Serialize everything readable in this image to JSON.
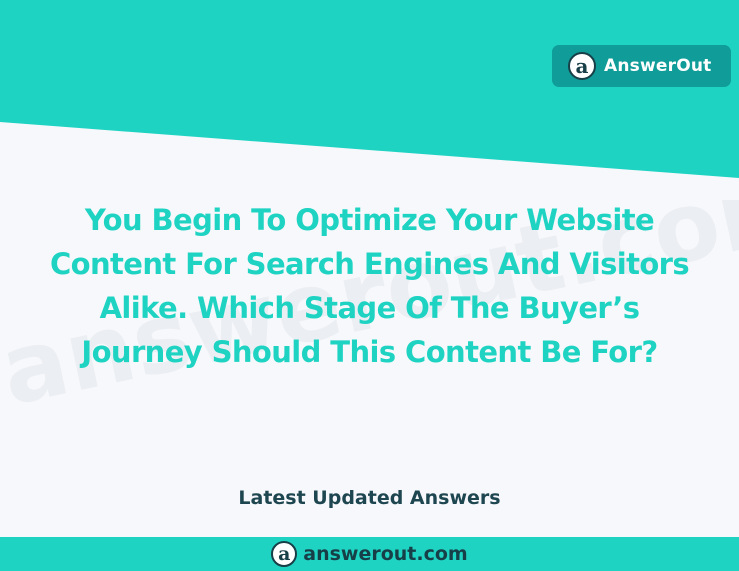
{
  "brand": {
    "logo_glyph": "a",
    "name": "AnswerOut"
  },
  "watermark": {
    "text": "answerout.com"
  },
  "question": {
    "line1": "You Begin To Optimize Your Website",
    "line2": "Content For Search Engines And Visitors",
    "line3": "Alike. Which Stage Of The Buyer’s",
    "line4": "Journey Should This Content Be For?"
  },
  "section": {
    "label": "Latest Updated Answers"
  },
  "footer": {
    "logo_glyph": "a",
    "url": "answerout.com"
  },
  "colors": {
    "teal": "#1fd3c3",
    "badge": "#109c98",
    "dark": "#173f48",
    "background": "#f7f8fb"
  }
}
